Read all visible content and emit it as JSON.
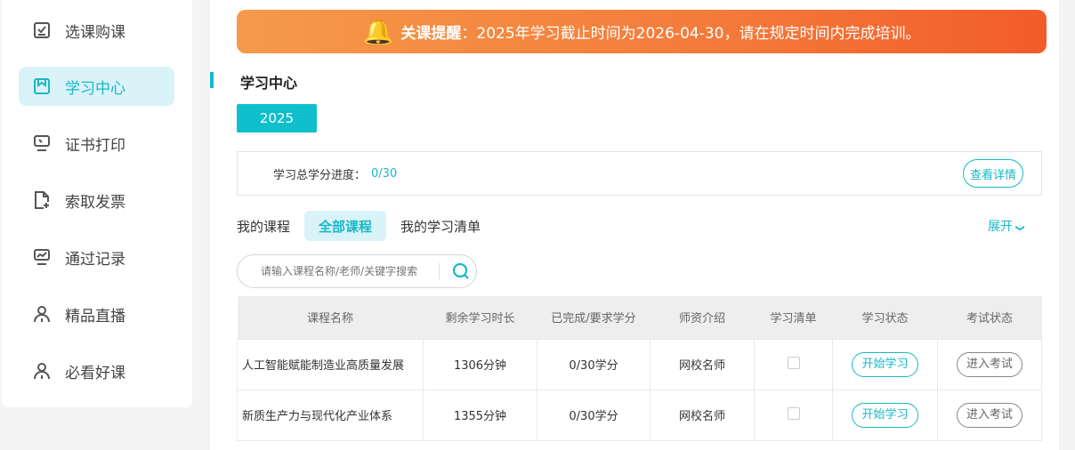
{
  "sidebar": {
    "items": [
      {
        "label": "选课购课",
        "icon": "checklist-icon"
      },
      {
        "label": "学习中心",
        "icon": "bookmark-icon",
        "active": true
      },
      {
        "label": "证书打印",
        "icon": "monitor-icon"
      },
      {
        "label": "索取发票",
        "icon": "file-plus-icon"
      },
      {
        "label": "通过记录",
        "icon": "chart-monitor-icon"
      },
      {
        "label": "精品直播",
        "icon": "user-icon"
      },
      {
        "label": "必看好课",
        "icon": "user-icon"
      }
    ]
  },
  "banner": {
    "label": "关课提醒",
    "text": "：2025年学习截止时间为2026-04-30，请在规定时间内完成培训。"
  },
  "section_title": "学习中心",
  "year": "2025",
  "progress": {
    "label": "学习总学分进度：",
    "value": "0/30",
    "detail": "查看详情"
  },
  "tabs": [
    "我的课程",
    "全部课程",
    "我的学习清单"
  ],
  "expand": "展开",
  "search": {
    "placeholder": "请输入课程名称/老师/关键字搜索"
  },
  "table": {
    "headers": [
      "课程名称",
      "剩余学习时长",
      "已完成/要求学分",
      "师资介绍",
      "学习清单",
      "学习状态",
      "考试状态"
    ],
    "rows": [
      {
        "name": "人工智能赋能制造业高质量发展",
        "remaining": "1306分钟",
        "credits": "0/30学分",
        "teacher": "网校名师",
        "study": "开始学习",
        "exam": "进入考试"
      },
      {
        "name": "新质生产力与现代化产业体系",
        "remaining": "1355分钟",
        "credits": "0/30学分",
        "teacher": "网校名师",
        "study": "开始学习",
        "exam": "进入考试"
      }
    ]
  }
}
